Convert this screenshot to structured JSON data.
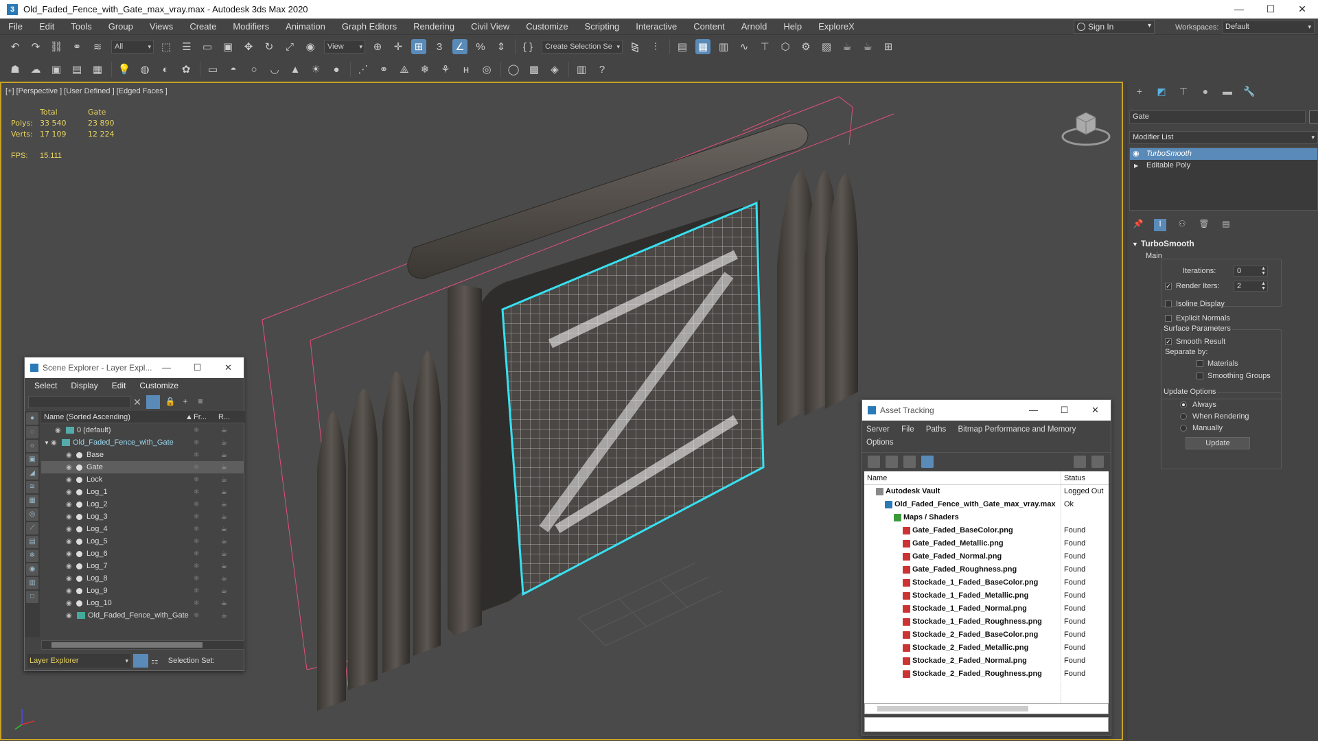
{
  "window": {
    "title": "Old_Faded_Fence_with_Gate_max_vray.max - Autodesk 3ds Max 2020",
    "controls": [
      "—",
      "☐",
      "✕"
    ]
  },
  "menu": [
    "File",
    "Edit",
    "Tools",
    "Group",
    "Views",
    "Create",
    "Modifiers",
    "Animation",
    "Graph Editors",
    "Rendering",
    "Civil View",
    "Customize",
    "Scripting",
    "Interactive",
    "Content",
    "Arnold",
    "Help",
    "ExploreX"
  ],
  "signin": {
    "label": "Sign In"
  },
  "workspace": {
    "label": "Workspaces:",
    "value": "Default"
  },
  "toolbar": {
    "filter": "All",
    "ref_coord": "View",
    "selection_set": "Create Selection Se"
  },
  "viewport": {
    "label": "[+] [Perspective ] [User Defined ] [Edged Faces ]",
    "stats": {
      "head_total": "Total",
      "head_gate": "Gate",
      "polys_label": "Polys:",
      "polys_total": "33 540",
      "polys_gate": "23 890",
      "verts_label": "Verts:",
      "verts_total": "17 109",
      "verts_gate": "12 224",
      "fps_label": "FPS:",
      "fps_value": "15.111"
    }
  },
  "scene_explorer": {
    "title": "Scene Explorer - Layer Expl...",
    "menu": [
      "Select",
      "Display",
      "Edit",
      "Customize"
    ],
    "col_name": "Name (Sorted Ascending)",
    "col_fr": "Fr...",
    "col_r": "R...",
    "rows": [
      {
        "name": "0 (default)",
        "indent": 0,
        "type": "layer"
      },
      {
        "name": "Old_Faded_Fence_with_Gate",
        "indent": 0,
        "type": "layer-open"
      },
      {
        "name": "Base",
        "indent": 1,
        "type": "obj"
      },
      {
        "name": "Gate",
        "indent": 1,
        "type": "obj",
        "selected": true
      },
      {
        "name": "Lock",
        "indent": 1,
        "type": "obj"
      },
      {
        "name": "Log_1",
        "indent": 1,
        "type": "obj"
      },
      {
        "name": "Log_2",
        "indent": 1,
        "type": "obj"
      },
      {
        "name": "Log_3",
        "indent": 1,
        "type": "obj"
      },
      {
        "name": "Log_4",
        "indent": 1,
        "type": "obj"
      },
      {
        "name": "Log_5",
        "indent": 1,
        "type": "obj"
      },
      {
        "name": "Log_6",
        "indent": 1,
        "type": "obj"
      },
      {
        "name": "Log_7",
        "indent": 1,
        "type": "obj"
      },
      {
        "name": "Log_8",
        "indent": 1,
        "type": "obj"
      },
      {
        "name": "Log_9",
        "indent": 1,
        "type": "obj"
      },
      {
        "name": "Log_10",
        "indent": 1,
        "type": "obj"
      },
      {
        "name": "Old_Faded_Fence_with_Gate",
        "indent": 1,
        "type": "group"
      }
    ],
    "footer_explorer": "Layer Explorer",
    "footer_selset": "Selection Set:"
  },
  "asset_tracking": {
    "title": "Asset Tracking",
    "menu": [
      "Server",
      "File",
      "Paths",
      "Bitmap Performance and Memory",
      "Options"
    ],
    "col_name": "Name",
    "col_status": "Status",
    "rows": [
      {
        "name": "Autodesk Vault",
        "status": "Logged Out",
        "indent": 1,
        "icon": "vault"
      },
      {
        "name": "Old_Faded_Fence_with_Gate_max_vray.max",
        "status": "Ok",
        "indent": 2,
        "icon": "max"
      },
      {
        "name": "Maps / Shaders",
        "status": "",
        "indent": 3,
        "icon": "fold"
      },
      {
        "name": "Gate_Faded_BaseColor.png",
        "status": "Found",
        "indent": 4,
        "icon": "png"
      },
      {
        "name": "Gate_Faded_Metallic.png",
        "status": "Found",
        "indent": 4,
        "icon": "png"
      },
      {
        "name": "Gate_Faded_Normal.png",
        "status": "Found",
        "indent": 4,
        "icon": "png"
      },
      {
        "name": "Gate_Faded_Roughness.png",
        "status": "Found",
        "indent": 4,
        "icon": "png"
      },
      {
        "name": "Stockade_1_Faded_BaseColor.png",
        "status": "Found",
        "indent": 4,
        "icon": "png"
      },
      {
        "name": "Stockade_1_Faded_Metallic.png",
        "status": "Found",
        "indent": 4,
        "icon": "png"
      },
      {
        "name": "Stockade_1_Faded_Normal.png",
        "status": "Found",
        "indent": 4,
        "icon": "png"
      },
      {
        "name": "Stockade_1_Faded_Roughness.png",
        "status": "Found",
        "indent": 4,
        "icon": "png"
      },
      {
        "name": "Stockade_2_Faded_BaseColor.png",
        "status": "Found",
        "indent": 4,
        "icon": "png"
      },
      {
        "name": "Stockade_2_Faded_Metallic.png",
        "status": "Found",
        "indent": 4,
        "icon": "png"
      },
      {
        "name": "Stockade_2_Faded_Normal.png",
        "status": "Found",
        "indent": 4,
        "icon": "png"
      },
      {
        "name": "Stockade_2_Faded_Roughness.png",
        "status": "Found",
        "indent": 4,
        "icon": "png"
      }
    ]
  },
  "command_panel": {
    "object_name": "Gate",
    "modifier_list": "Modifier List",
    "stack": [
      "TurboSmooth",
      "Editable Poly"
    ],
    "rollout_title": "TurboSmooth",
    "main_group": "Main",
    "iterations_label": "Iterations:",
    "iterations_value": "0",
    "render_iters_label": "Render Iters:",
    "render_iters_value": "2",
    "isoline": "Isoline Display",
    "explicit_normals": "Explicit Normals",
    "surface_group": "Surface Parameters",
    "smooth_result": "Smooth Result",
    "separate_by": "Separate by:",
    "materials": "Materials",
    "smoothing_groups": "Smoothing Groups",
    "update_group": "Update Options",
    "always": "Always",
    "when_rendering": "When Rendering",
    "manually": "Manually",
    "update_btn": "Update"
  },
  "colors": {
    "accent": "#5a8ab8",
    "viewport_border": "#c9a227",
    "stats_text": "#e8d460",
    "selection_outline": "#38e0f0",
    "bbox": "#e0507a"
  }
}
